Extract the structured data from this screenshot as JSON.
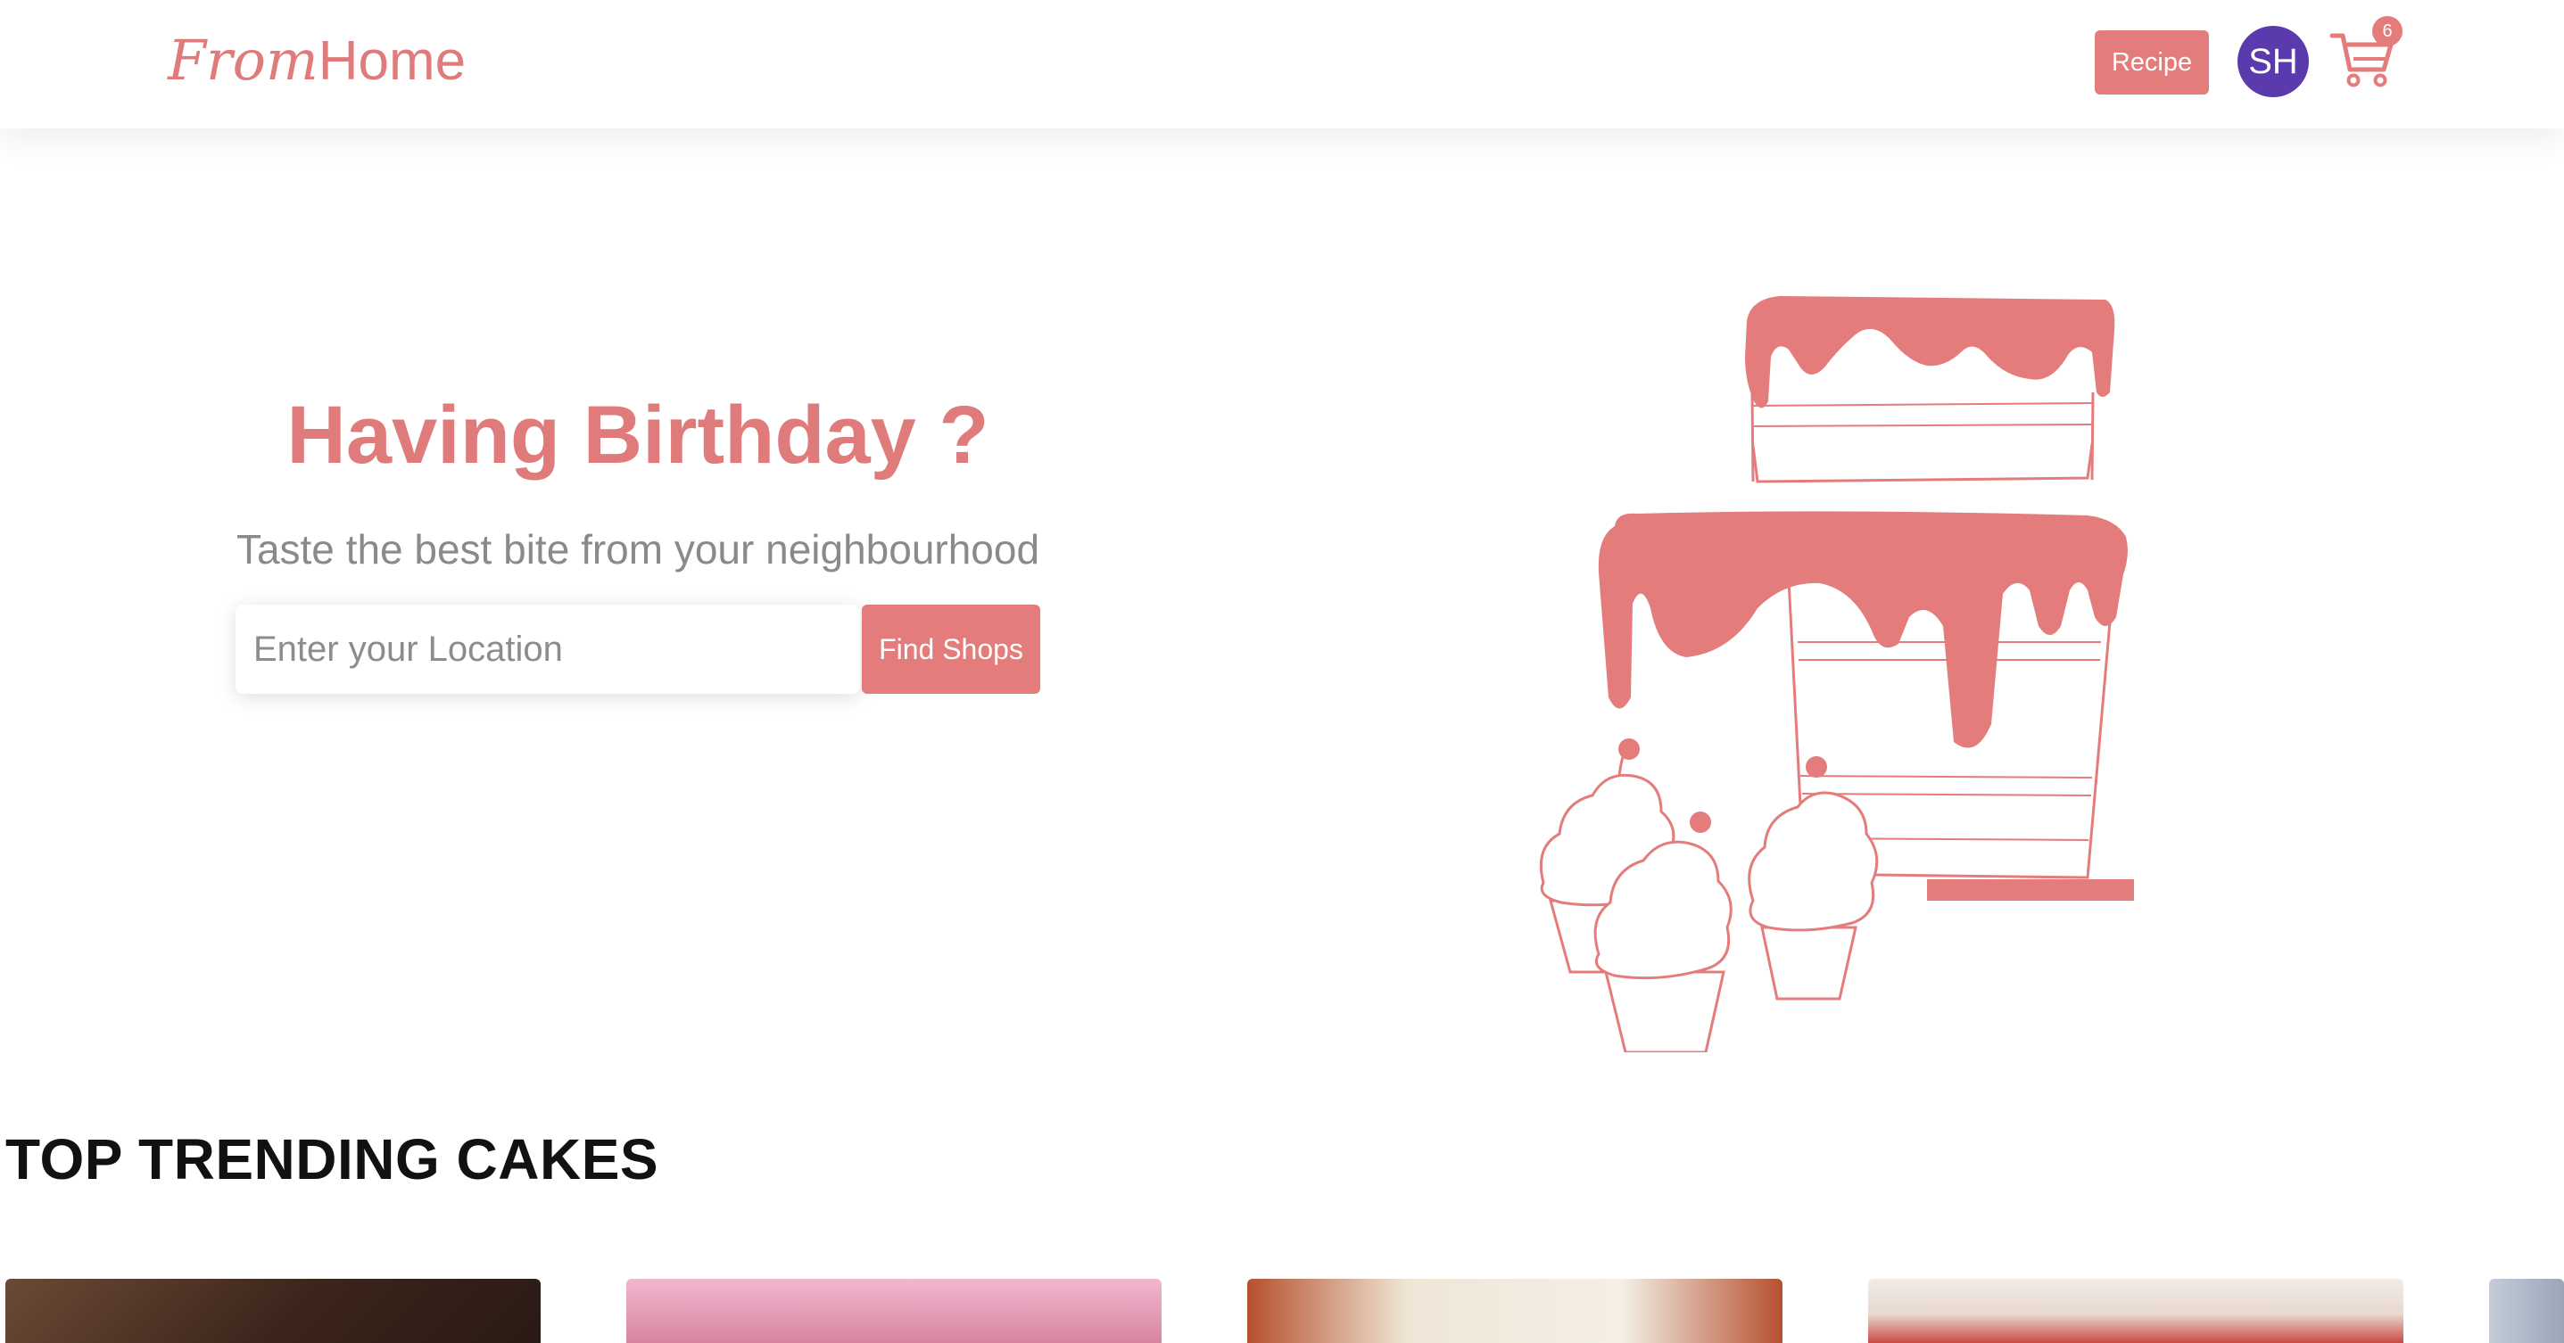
{
  "brand": {
    "logo_from": "From",
    "logo_home": "Home",
    "color": "#e07b7b"
  },
  "header": {
    "recipe_label": "Recipe",
    "avatar_initials": "SH",
    "cart_count": "6",
    "cart_icon": "shopping-cart-icon"
  },
  "hero": {
    "title": "Having Birthday ?",
    "subtitle": "Taste the best bite from your neighbourhood",
    "search": {
      "placeholder": "Enter your Location",
      "value": ""
    },
    "find_label": "Find Shops",
    "illustration_icon": "birthday-cake-illustration"
  },
  "trending": {
    "title": "TOP TRENDING CAKES",
    "cards": [
      {
        "name": "cake-card-chocolate",
        "colors": [
          "#5a3a2a",
          "#3b241b"
        ]
      },
      {
        "name": "cake-card-pink-birthday",
        "colors": [
          "#e9a9c6",
          "#d4829f"
        ]
      },
      {
        "name": "cake-card-cream",
        "colors": [
          "#b5502e",
          "#efe6d6"
        ]
      },
      {
        "name": "cake-card-red-velvet",
        "colors": [
          "#f2ece6",
          "#c94a43"
        ]
      },
      {
        "name": "cake-card-partial",
        "colors": [
          "#c4ccd8",
          "#9aa6b8"
        ]
      }
    ]
  },
  "colors": {
    "accent": "#e57c7c",
    "avatar": "#5b3aad",
    "title": "#111111"
  }
}
